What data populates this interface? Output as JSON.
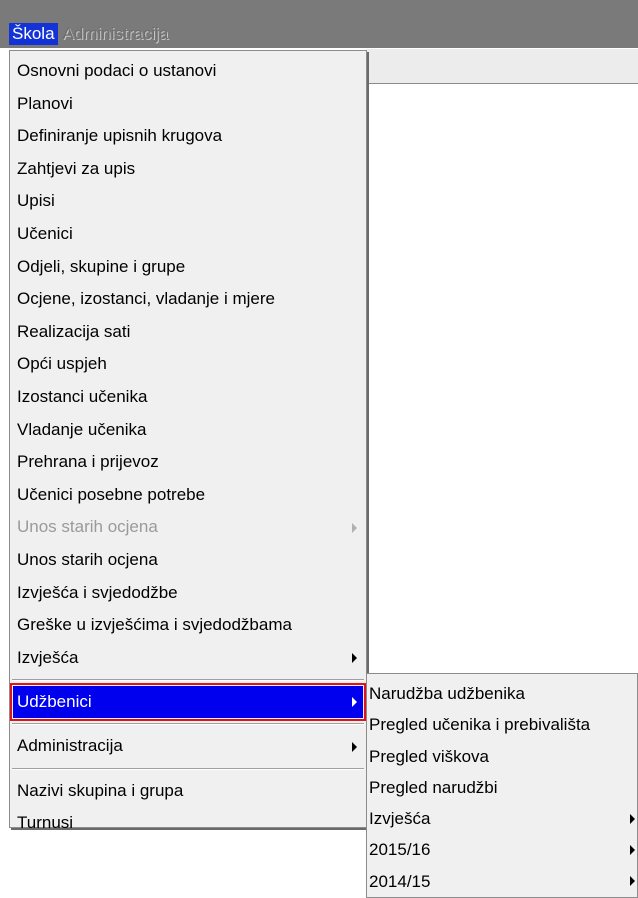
{
  "menubar": {
    "items": [
      {
        "label": "Škola"
      },
      {
        "label": "Administracija"
      }
    ]
  },
  "main_menu": {
    "items": [
      {
        "label": "Osnovni podaci o ustanovi"
      },
      {
        "label": "Planovi"
      },
      {
        "label": "Definiranje upisnih krugova"
      },
      {
        "label": "Zahtjevi za upis"
      },
      {
        "label": "Upisi"
      },
      {
        "label": "Učenici"
      },
      {
        "label": "Odjeli, skupine i grupe"
      },
      {
        "label": "Ocjene, izostanci, vladanje i mjere"
      },
      {
        "label": "Realizacija sati"
      },
      {
        "label": "Opći uspjeh"
      },
      {
        "label": "Izostanci učenika"
      },
      {
        "label": "Vladanje učenika"
      },
      {
        "label": "Prehrana i prijevoz"
      },
      {
        "label": "Učenici posebne potrebe"
      },
      {
        "label": "Unos starih ocjena"
      },
      {
        "label": "Unos starih ocjena"
      },
      {
        "label": "Izvješća i svjedodžbe"
      },
      {
        "label": "Greške u izvješćima i svjedodžbama"
      },
      {
        "label": "Izvješća"
      },
      {
        "label": "Udžbenici"
      },
      {
        "label": "Administracija"
      },
      {
        "label": "Nazivi skupina i grupa"
      },
      {
        "label": "Turnusi"
      }
    ]
  },
  "sub_menu": {
    "items": [
      {
        "label": "Narudžba udžbenika"
      },
      {
        "label": "Pregled učenika i prebivališta"
      },
      {
        "label": "Pregled viškova"
      },
      {
        "label": "Pregled narudžbi"
      },
      {
        "label": "Izvješća"
      },
      {
        "label": "2015/16"
      },
      {
        "label": "2014/15"
      }
    ]
  },
  "colors": {
    "menubar_bg": "#7a7a7a",
    "menu_bg": "#f0f0f0",
    "selection": "#0000ee",
    "highlight_border": "#e0121a",
    "disabled_text": "#9a9a9a"
  }
}
